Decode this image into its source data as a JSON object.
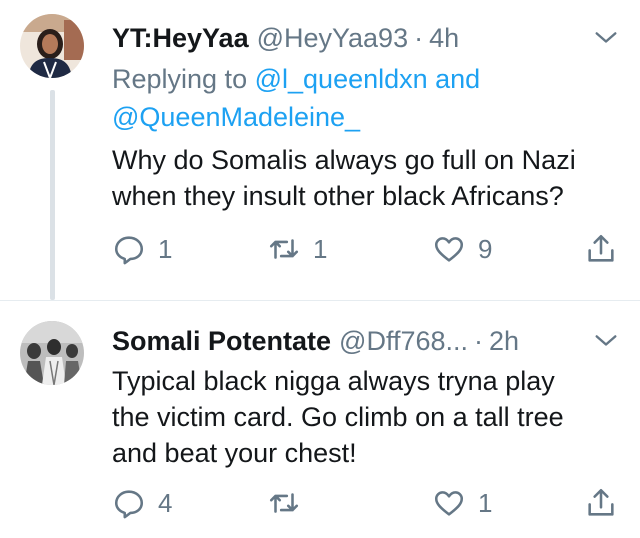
{
  "tweets": [
    {
      "name": "YT:HeyYaa",
      "handle": "@HeyYaa93",
      "dot": "·",
      "time": "4h",
      "reply_prefix": "Replying to",
      "reply_mention_1": "@l_queenldxn and",
      "reply_mention_2": "@QueenMadeleine_",
      "text_lines": [
        "Why do Somalis always go full on Nazi",
        "when they insult other black Africans?"
      ],
      "reply_count": "1",
      "retweet_count": "1",
      "like_count": "9"
    },
    {
      "name": "Somali Potentate",
      "handle": "@Dff768...",
      "dot": "·",
      "time": "2h",
      "text_lines": [
        "Typical black nigga always tryna play",
        "the victim card. Go climb on a tall tree",
        "and beat your chest!"
      ],
      "reply_count": "4",
      "retweet_count": "",
      "like_count": "1"
    }
  ],
  "colors": {
    "text": "#14171a",
    "secondary": "#657786",
    "link": "#1da1f2",
    "thread": "#dbe1e6"
  },
  "icons": [
    "reply-icon",
    "retweet-icon",
    "like-icon",
    "share-icon",
    "chevron-down-icon"
  ]
}
